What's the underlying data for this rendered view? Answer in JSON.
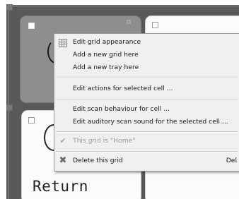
{
  "grid_cells": {
    "bottom_left_label": "Return"
  },
  "context_menu": {
    "items": [
      {
        "label": "Edit grid appearance",
        "icon": "grid-icon",
        "enabled": true
      },
      {
        "label": "Add a new grid here",
        "enabled": true
      },
      {
        "label": "Add a new tray here",
        "enabled": true
      },
      {
        "label": "Edit actions for selected cell ...",
        "enabled": true
      },
      {
        "label": "Edit scan behaviour for cell ...",
        "enabled": true
      },
      {
        "label": "Edit auditory scan sound for the selected cell ...",
        "enabled": true
      },
      {
        "label": "This grid is \"Home\"",
        "icon": "check-icon",
        "enabled": false
      },
      {
        "label": "Delete this grid",
        "icon": "delete-x-icon",
        "shortcut": "Del",
        "enabled": true
      }
    ]
  },
  "colors": {
    "grid_background": "#595959",
    "menu_background": "#f0f0f0",
    "delete_icon": "#6a6a6a",
    "check_icon": "#9aa8c0"
  }
}
